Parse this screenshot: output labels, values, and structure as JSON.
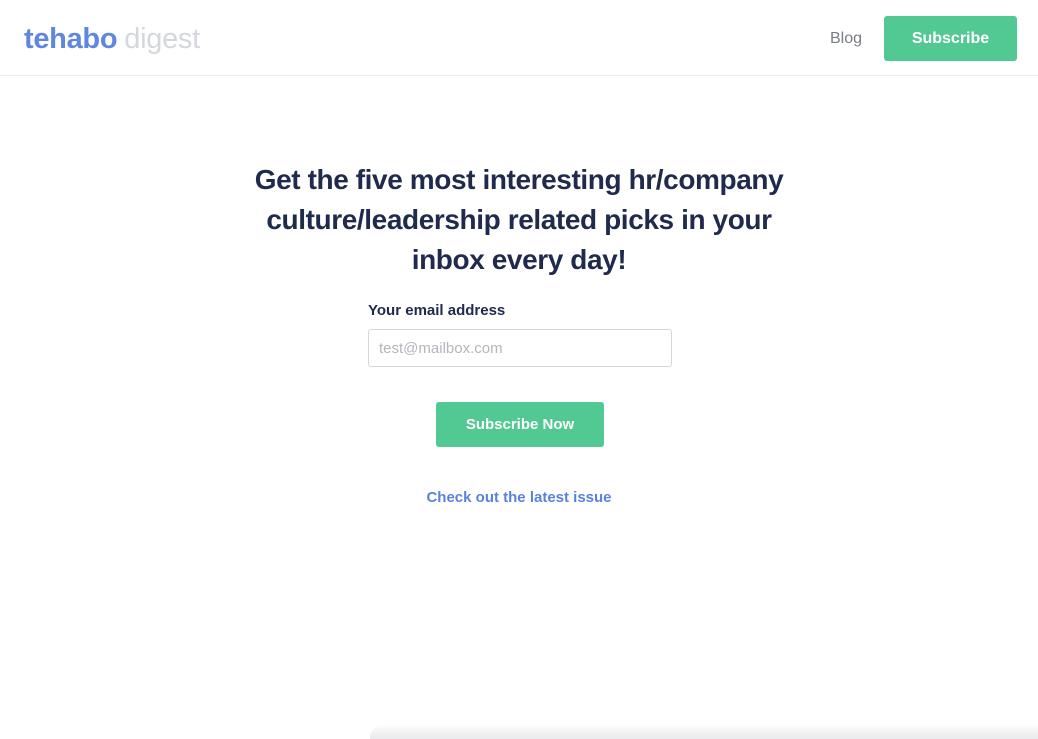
{
  "header": {
    "logo_brand": "tehabo",
    "logo_suffix": "digest",
    "nav_blog": "Blog",
    "subscribe_label": "Subscribe"
  },
  "hero": {
    "headline": "Get the five most interesting hr/company culture/leadership related picks in your inbox every day!",
    "email_label": "Your email address",
    "email_placeholder": "test@mailbox.com",
    "email_value": "",
    "cta_label": "Subscribe Now",
    "latest_link": "Check out the latest issue"
  },
  "colors": {
    "brand_blue": "#5f86e0",
    "accent_green": "#52c893",
    "headline_navy": "#1f2a4d",
    "link_blue": "#5a82dc"
  }
}
